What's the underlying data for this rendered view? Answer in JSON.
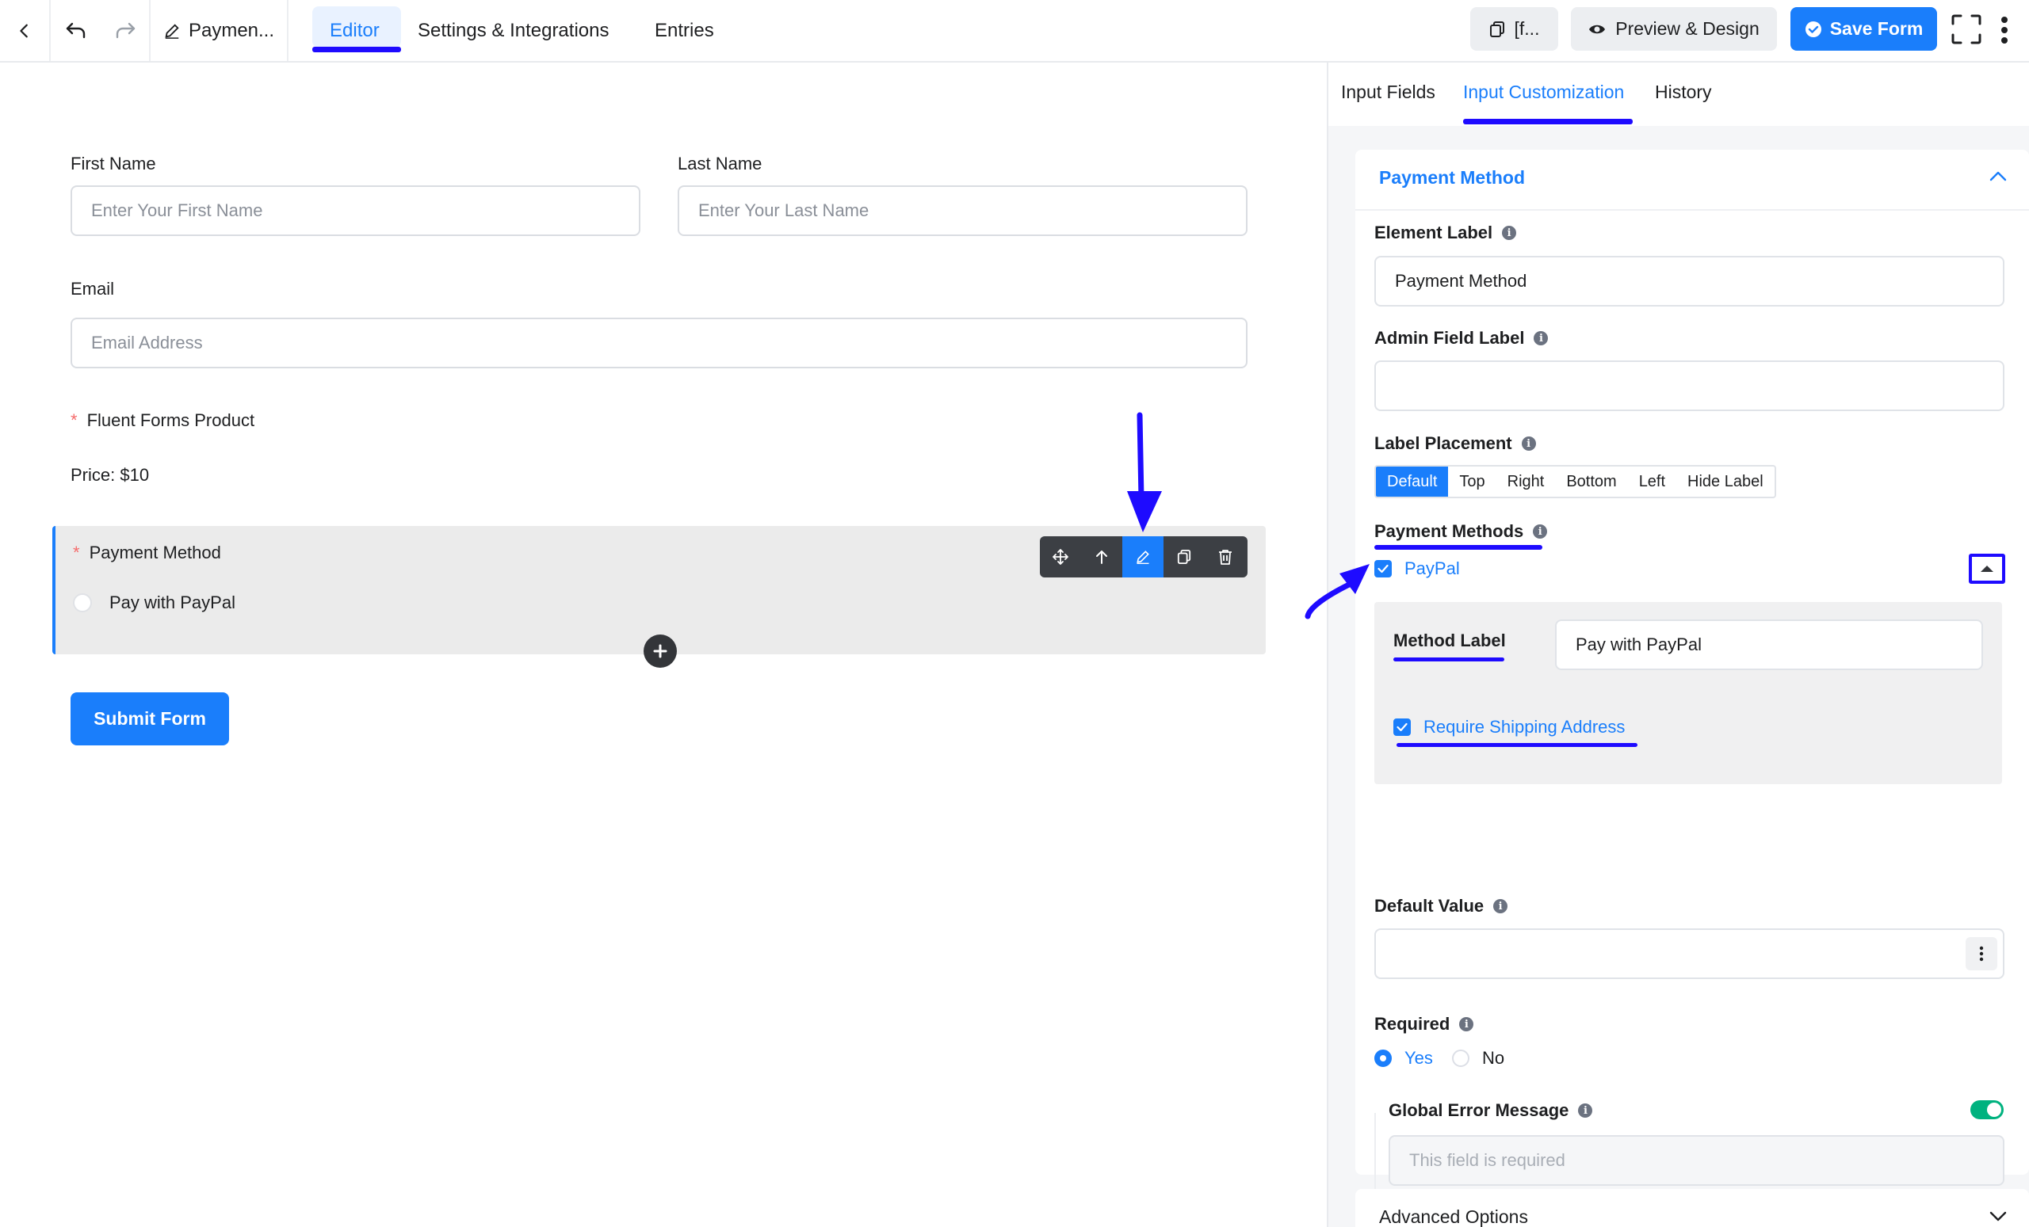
{
  "topbar": {
    "form_title": "Paymen...",
    "tabs": [
      {
        "label": "Editor",
        "active": true
      },
      {
        "label": "Settings & Integrations",
        "active": false
      },
      {
        "label": "Entries",
        "active": false
      }
    ],
    "shortcode_label": "[f...",
    "preview_label": "Preview & Design",
    "save_label": "Save Form"
  },
  "form": {
    "first_name": {
      "label": "First Name",
      "placeholder": "Enter Your First Name"
    },
    "last_name": {
      "label": "Last Name",
      "placeholder": "Enter Your Last Name"
    },
    "email": {
      "label": "Email",
      "placeholder": "Email Address"
    },
    "product": {
      "label": "Fluent Forms Product",
      "price": "Price: $10"
    },
    "payment_method": {
      "label": "Payment Method",
      "option": "Pay with PayPal"
    },
    "submit_label": "Submit Form"
  },
  "sidebar": {
    "tabs": [
      {
        "label": "Input Fields",
        "active": false
      },
      {
        "label": "Input Customization",
        "active": true
      },
      {
        "label": "History",
        "active": false
      }
    ],
    "section_title": "Payment Method",
    "element_label": {
      "label": "Element Label",
      "value": "Payment Method"
    },
    "admin_field_label": {
      "label": "Admin Field Label",
      "value": ""
    },
    "label_placement": {
      "label": "Label Placement",
      "options": [
        "Default",
        "Top",
        "Right",
        "Bottom",
        "Left",
        "Hide Label"
      ],
      "selected": "Default"
    },
    "payment_methods": {
      "label": "Payment Methods",
      "method_name": "PayPal",
      "checked": true,
      "method_label_caption": "Method Label",
      "method_label_value": "Pay with PayPal",
      "require_shipping_label": "Require Shipping Address",
      "require_shipping_checked": true
    },
    "default_value": {
      "label": "Default Value",
      "value": ""
    },
    "required": {
      "label": "Required",
      "yes": "Yes",
      "no": "No",
      "selected": "Yes"
    },
    "global_error": {
      "label": "Global Error Message",
      "enabled": true,
      "placeholder": "This field is required"
    },
    "advanced_options": "Advanced Options"
  },
  "colors": {
    "accent": "#1a7efb",
    "annotation": "#1e0bff",
    "toggle_on": "#00b27f",
    "required_star": "#f56c6c"
  }
}
